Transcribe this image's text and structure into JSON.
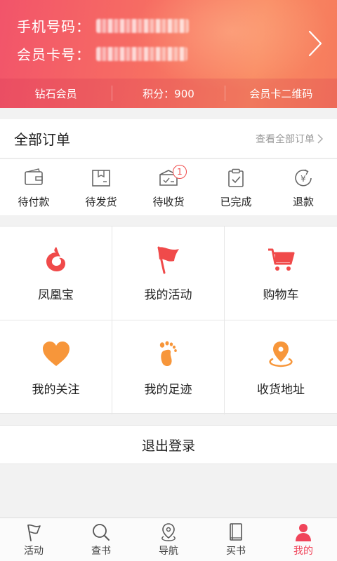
{
  "header": {
    "phone_label": "手机号码：",
    "card_label": "会员卡号：",
    "bar": [
      "钻石会员",
      "积分：900",
      "会员卡二维码"
    ]
  },
  "orders": {
    "title": "全部订单",
    "view_all": "查看全部订单",
    "items": [
      {
        "label": "待付款",
        "icon": "wallet-icon"
      },
      {
        "label": "待发货",
        "icon": "package-icon"
      },
      {
        "label": "待收货",
        "icon": "delivery-box-icon",
        "badge": "1"
      },
      {
        "label": "已完成",
        "icon": "clipboard-check-icon"
      },
      {
        "label": "退款",
        "icon": "yen-refund-icon"
      }
    ]
  },
  "grid": [
    {
      "label": "凤凰宝",
      "icon": "phoenix-icon"
    },
    {
      "label": "我的活动",
      "icon": "flag-icon"
    },
    {
      "label": "购物车",
      "icon": "cart-icon"
    },
    {
      "label": "我的关注",
      "icon": "heart-icon"
    },
    {
      "label": "我的足迹",
      "icon": "footprint-icon"
    },
    {
      "label": "收货地址",
      "icon": "location-pin-icon"
    }
  ],
  "logout_label": "退出登录",
  "tabs": [
    {
      "label": "活动",
      "icon": "flag-outline-icon"
    },
    {
      "label": "查书",
      "icon": "search-icon"
    },
    {
      "label": "导航",
      "icon": "map-pin-icon"
    },
    {
      "label": "买书",
      "icon": "book-icon"
    },
    {
      "label": "我的",
      "icon": "user-icon",
      "active": true
    }
  ],
  "colors": {
    "accent": "#f0445a",
    "icon_red": "#f04a4a",
    "icon_orange": "#f7963a",
    "icon_gray": "#666666"
  }
}
